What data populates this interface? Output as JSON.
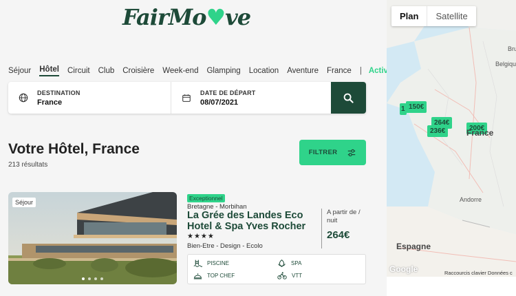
{
  "brand": {
    "logo_text_start": "FairMo",
    "logo_text_accent": "♥",
    "logo_text_end": "ve"
  },
  "nav": {
    "items": [
      "Séjour",
      "Hôtel",
      "Circuit",
      "Club",
      "Croisière",
      "Week-end",
      "Glamping",
      "Location",
      "Aventure",
      "France"
    ],
    "separator": "|",
    "activities": "Activités",
    "active_index": 1
  },
  "search": {
    "destination_label": "DESTINATION",
    "destination_value": "France",
    "date_label": "DATE DE DÉPART",
    "date_value": "08/07/2021"
  },
  "results": {
    "title": "Votre Hôtel, France",
    "count": "213 résultats",
    "filter_label": "FILTRER"
  },
  "listing": {
    "photo_tag": "Séjour",
    "badge": "Exceptionnel",
    "region": "Bretagne - Morbihan",
    "name": "La Grée des Landes Eco Hotel & Spa Yves Rocher",
    "stars": "★★★★",
    "tags": "Bien-Etre - Design - Ecolo",
    "price_prefix": "A partir de / nuit",
    "price": "264€",
    "amenities": [
      {
        "label": "PISCINE",
        "icon": "pool-icon"
      },
      {
        "label": "SPA",
        "icon": "spa-icon"
      },
      {
        "label": "TOP CHEF",
        "icon": "chef-icon"
      },
      {
        "label": "VTT",
        "icon": "bike-icon"
      }
    ]
  },
  "map": {
    "mode_plan": "Plan",
    "mode_satellite": "Satellite",
    "pins": [
      "1",
      "150€",
      "264€",
      "236€",
      "200€"
    ],
    "labels": {
      "belgique": "Belgiqu",
      "france": "France",
      "andorre": "Andorre",
      "espagne": "Espagne",
      "brux": "Bru"
    },
    "google": "Google",
    "attribution": "Raccourcis clavier  Données c"
  },
  "colors": {
    "brand_dark": "#1d4a38",
    "brand_green": "#2fd38a"
  }
}
